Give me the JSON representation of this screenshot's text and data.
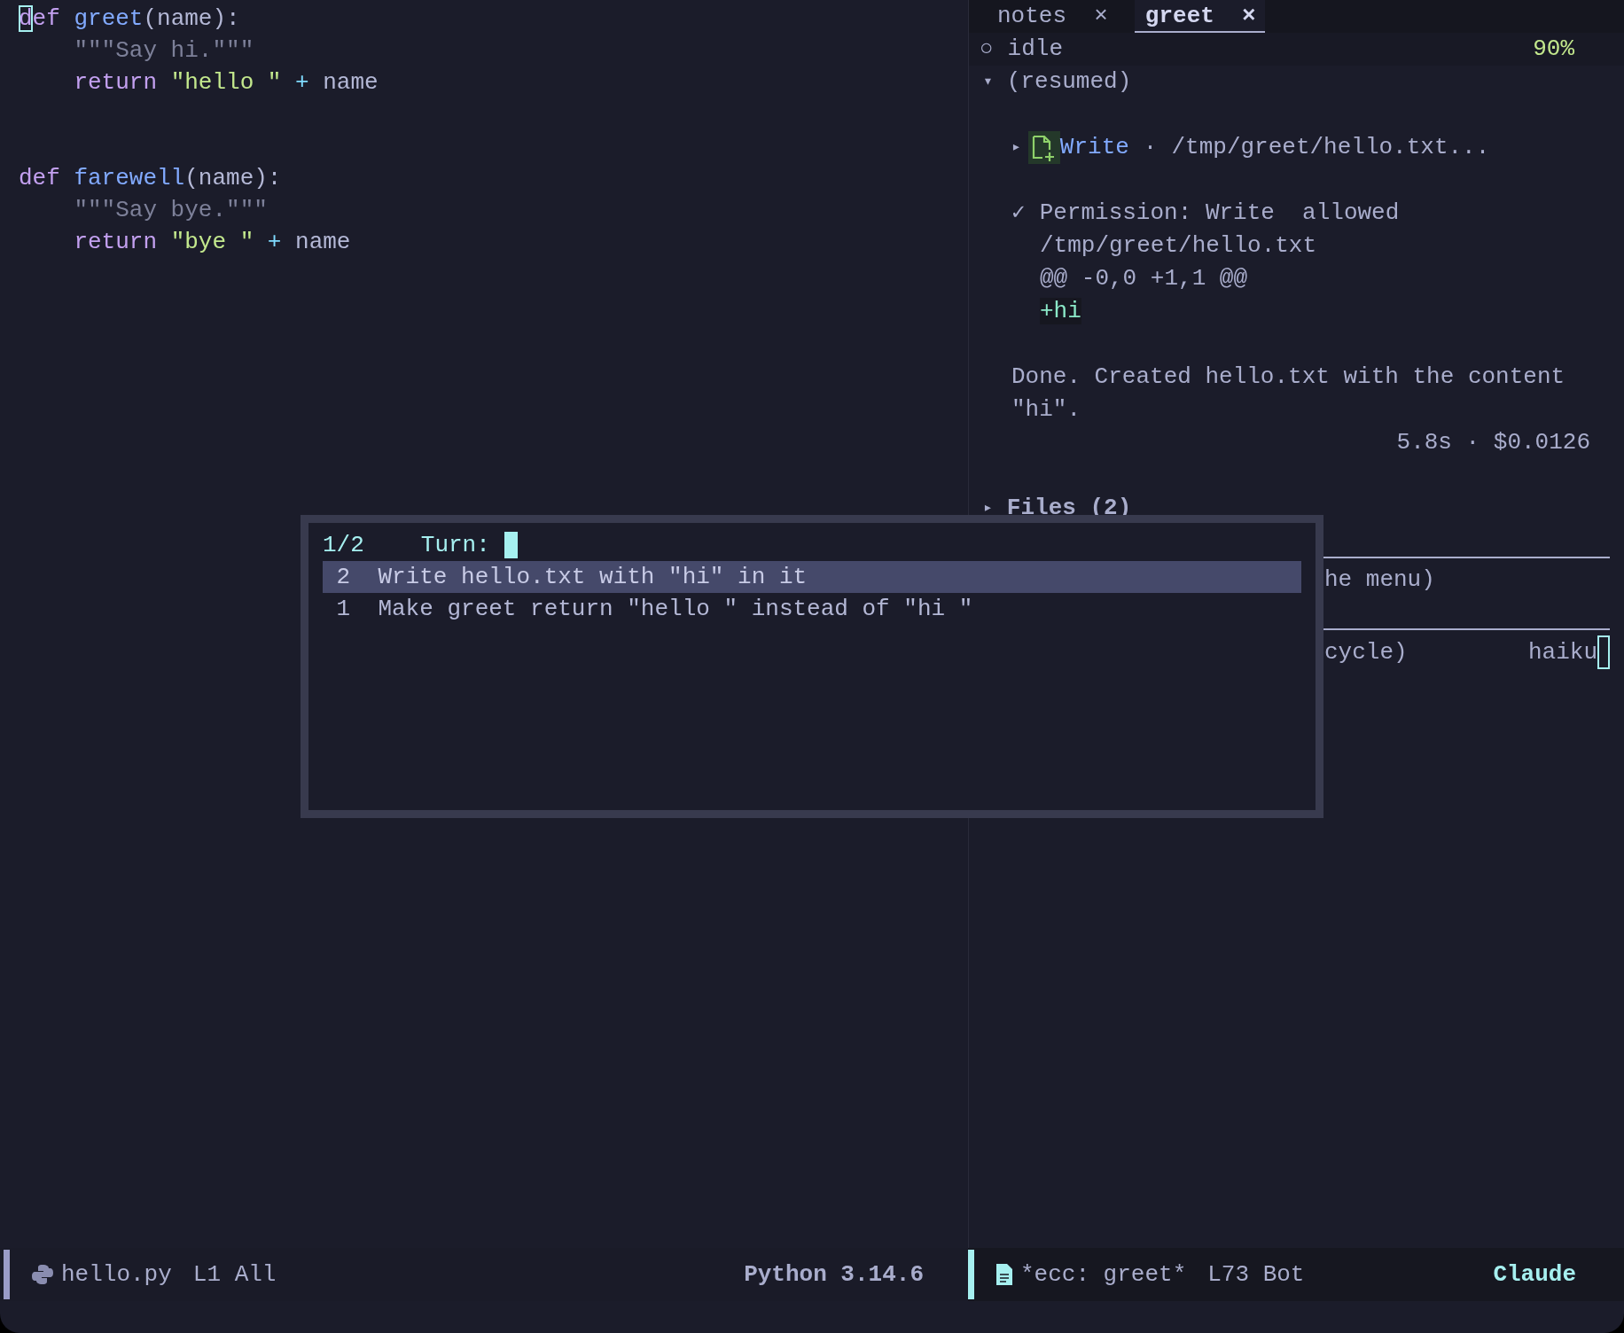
{
  "editor": {
    "lines": [
      {
        "kind": "code",
        "indent": false,
        "tokens": [
          {
            "kind": "cursor",
            "text": "d"
          },
          {
            "kind": "keyword",
            "text": "ef",
            "space_after": true
          },
          {
            "kind": "function",
            "text": "greet"
          },
          {
            "kind": "plain",
            "text": "(name):"
          }
        ]
      },
      {
        "kind": "code",
        "indent": true,
        "tokens": [
          {
            "kind": "docstring",
            "text": "\"\"\"Say hi.\"\"\""
          }
        ]
      },
      {
        "kind": "code",
        "indent": true,
        "tokens": [
          {
            "kind": "keyword",
            "text": "return",
            "space_after": true
          },
          {
            "kind": "string",
            "text": "\"hello \"",
            "space_after": true
          },
          {
            "kind": "operator",
            "text": "+",
            "space_after": true
          },
          {
            "kind": "plain",
            "text": "name"
          }
        ]
      },
      {
        "kind": "blank"
      },
      {
        "kind": "blank"
      },
      {
        "kind": "code",
        "indent": false,
        "tokens": [
          {
            "kind": "keyword",
            "text": "def",
            "space_after": true
          },
          {
            "kind": "function",
            "text": "farewell"
          },
          {
            "kind": "plain",
            "text": "(name):"
          }
        ]
      },
      {
        "kind": "code",
        "indent": true,
        "tokens": [
          {
            "kind": "docstring",
            "text": "\"\"\"Say bye.\"\"\""
          }
        ]
      },
      {
        "kind": "code",
        "indent": true,
        "tokens": [
          {
            "kind": "keyword",
            "text": "return",
            "space_after": true
          },
          {
            "kind": "string",
            "text": "\"bye \"",
            "space_after": true
          },
          {
            "kind": "operator",
            "text": "+",
            "space_after": true
          },
          {
            "kind": "plain",
            "text": "name"
          }
        ]
      }
    ]
  },
  "chat": {
    "tabs": [
      {
        "label": "notes",
        "close": "×",
        "selected": false
      },
      {
        "label": "greet",
        "close": "×",
        "selected": true
      }
    ],
    "status": {
      "indicator": "○",
      "state": "idle",
      "percent": "90%"
    },
    "transcript": [
      {
        "kind": "heading",
        "marker": "▾",
        "text": "(resumed)"
      },
      {
        "kind": "blank"
      },
      {
        "kind": "tool",
        "marker": "▸",
        "tool": "Write",
        "separator": "·",
        "detail": "/tmp/greet/hello.txt..."
      },
      {
        "kind": "blank"
      },
      {
        "kind": "permission",
        "marker": "✓",
        "text": "Permission: Write  allowed"
      },
      {
        "kind": "detail",
        "text": "/tmp/greet/hello.txt"
      },
      {
        "kind": "detail",
        "text": "@@ -0,0 +1,1 @@"
      },
      {
        "kind": "added",
        "text": "+hi"
      },
      {
        "kind": "blank"
      },
      {
        "kind": "message",
        "text": "Done. Created hello.txt with the content \"hi\"."
      },
      {
        "kind": "stats",
        "text": "5.8s · $0.0126"
      },
      {
        "kind": "blank"
      },
      {
        "kind": "section",
        "marker": "▸",
        "text": "Files (2)"
      },
      {
        "kind": "rule"
      },
      {
        "kind": "fragment",
        "text": "he menu)"
      },
      {
        "kind": "rule"
      },
      {
        "kind": "input",
        "text": "cycle)",
        "model": "haiku"
      }
    ]
  },
  "popup": {
    "counter": "1/2",
    "label": "Turn:",
    "items": [
      {
        "number": "2",
        "text": "Write hello.txt with \"hi\" in it",
        "selected": true
      },
      {
        "number": "1",
        "text": "Make greet return \"hello \" instead of \"hi \"",
        "selected": false
      }
    ]
  },
  "status_bar": {
    "left": {
      "file": "hello.py",
      "position": "L1 All",
      "mode": "Python 3.14.6"
    },
    "right": {
      "buffer": "*ecc: greet*",
      "position": "L73 Bot",
      "mode": "Claude"
    }
  }
}
